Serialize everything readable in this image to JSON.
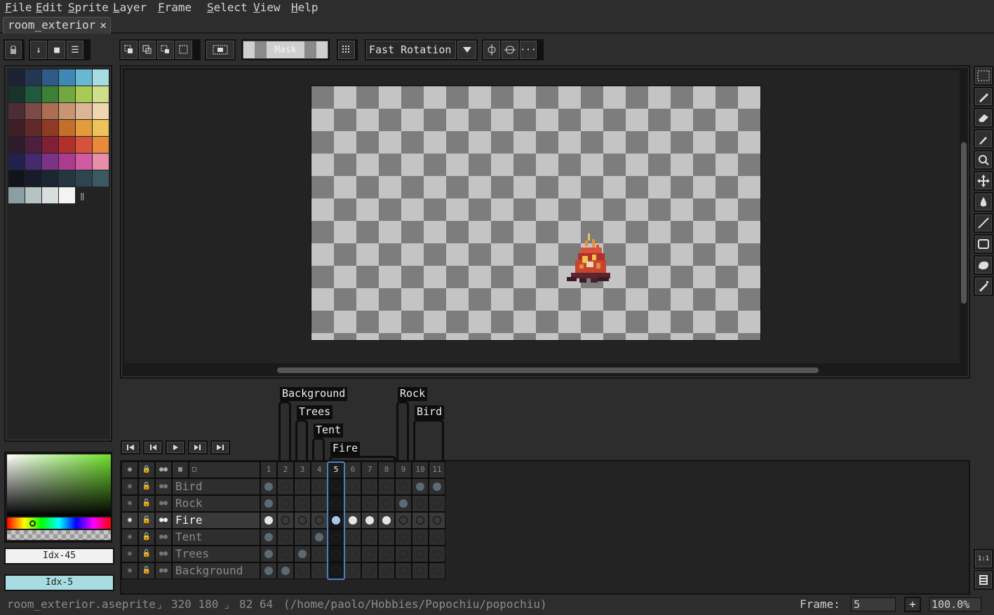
{
  "menu": [
    "File",
    "Edit",
    "Sprite",
    "Layer",
    "Frame",
    "Select",
    "View",
    "Help"
  ],
  "tab": {
    "label": "room_exterior",
    "close": "✕"
  },
  "toolbar": {
    "mask_label": "Mask",
    "rotation_algorithm": "Fast Rotation",
    "more_label": "···"
  },
  "palette": {
    "rows": [
      [
        "#1d2233",
        "#243752",
        "#305a88",
        "#3f87b5",
        "#68b8d2",
        "#a7dde2"
      ],
      [
        "#1a3329",
        "#20593c",
        "#3d7f37",
        "#72a83f",
        "#a8cb53",
        "#d0de8c"
      ],
      [
        "#4b2e35",
        "#7e4a48",
        "#ad6d52",
        "#c99471",
        "#dcb598",
        "#eed6b3"
      ],
      [
        "#3f1f25",
        "#62282a",
        "#8f3a24",
        "#c46f29",
        "#e29c3b",
        "#eec35a"
      ],
      [
        "#2e1c2c",
        "#4d1f3c",
        "#7f2034",
        "#b2302c",
        "#d6533a",
        "#e88a3a"
      ],
      [
        "#22214b",
        "#462a6e",
        "#7b3485",
        "#ab3b8f",
        "#d15b9f",
        "#e88eaa"
      ],
      [
        "#12131c",
        "#171b2a",
        "#1c2633",
        "#243640",
        "#2e4550",
        "#3c5962"
      ],
      [
        "#8b9ea3",
        "#b5c3c3",
        "#d8dede",
        "#f3f3f3"
      ]
    ]
  },
  "colors": {
    "fg_label": "Idx-45",
    "fg_color": "#f1f2ef",
    "bg_label": "Idx-5",
    "bg_color": "#a7dde2"
  },
  "timeline": {
    "frames": [
      "1",
      "2",
      "3",
      "4",
      "5",
      "6",
      "7",
      "8",
      "9",
      "10",
      "11"
    ],
    "current_frame_index": 4,
    "tags": [
      "Background",
      "Trees",
      "Tent",
      "Fire",
      "Rock",
      "Bird"
    ],
    "layers": [
      {
        "name": "Bird",
        "cels": [
          1,
          0,
          0,
          0,
          0,
          0,
          0,
          0,
          0,
          1,
          1
        ],
        "active": false
      },
      {
        "name": "Rock",
        "cels": [
          1,
          0,
          0,
          0,
          0,
          0,
          0,
          0,
          1,
          0,
          0
        ],
        "active": false
      },
      {
        "name": "Fire",
        "cels": [
          1,
          0,
          0,
          0,
          1,
          1,
          1,
          1,
          0,
          0,
          0
        ],
        "active": true
      },
      {
        "name": "Tent",
        "cels": [
          1,
          0,
          0,
          1,
          0,
          0,
          0,
          0,
          0,
          0,
          0
        ],
        "active": false
      },
      {
        "name": "Trees",
        "cels": [
          1,
          0,
          1,
          0,
          0,
          0,
          0,
          0,
          0,
          0,
          0
        ],
        "active": false
      },
      {
        "name": "Background",
        "cels": [
          1,
          1,
          0,
          0,
          0,
          0,
          0,
          0,
          0,
          0,
          0
        ],
        "active": false
      }
    ]
  },
  "status": {
    "filename": "room_exterior.aseprite",
    "size": "320 180",
    "position": "82 64",
    "path": "(/home/paolo/Hobbies/Popochiu/popochiu)",
    "frame_label": "Frame:",
    "frame_value": "5",
    "zoom": "100.0%",
    "add": "+"
  },
  "zoom_controls": {
    "one_to_one": "1:1"
  }
}
